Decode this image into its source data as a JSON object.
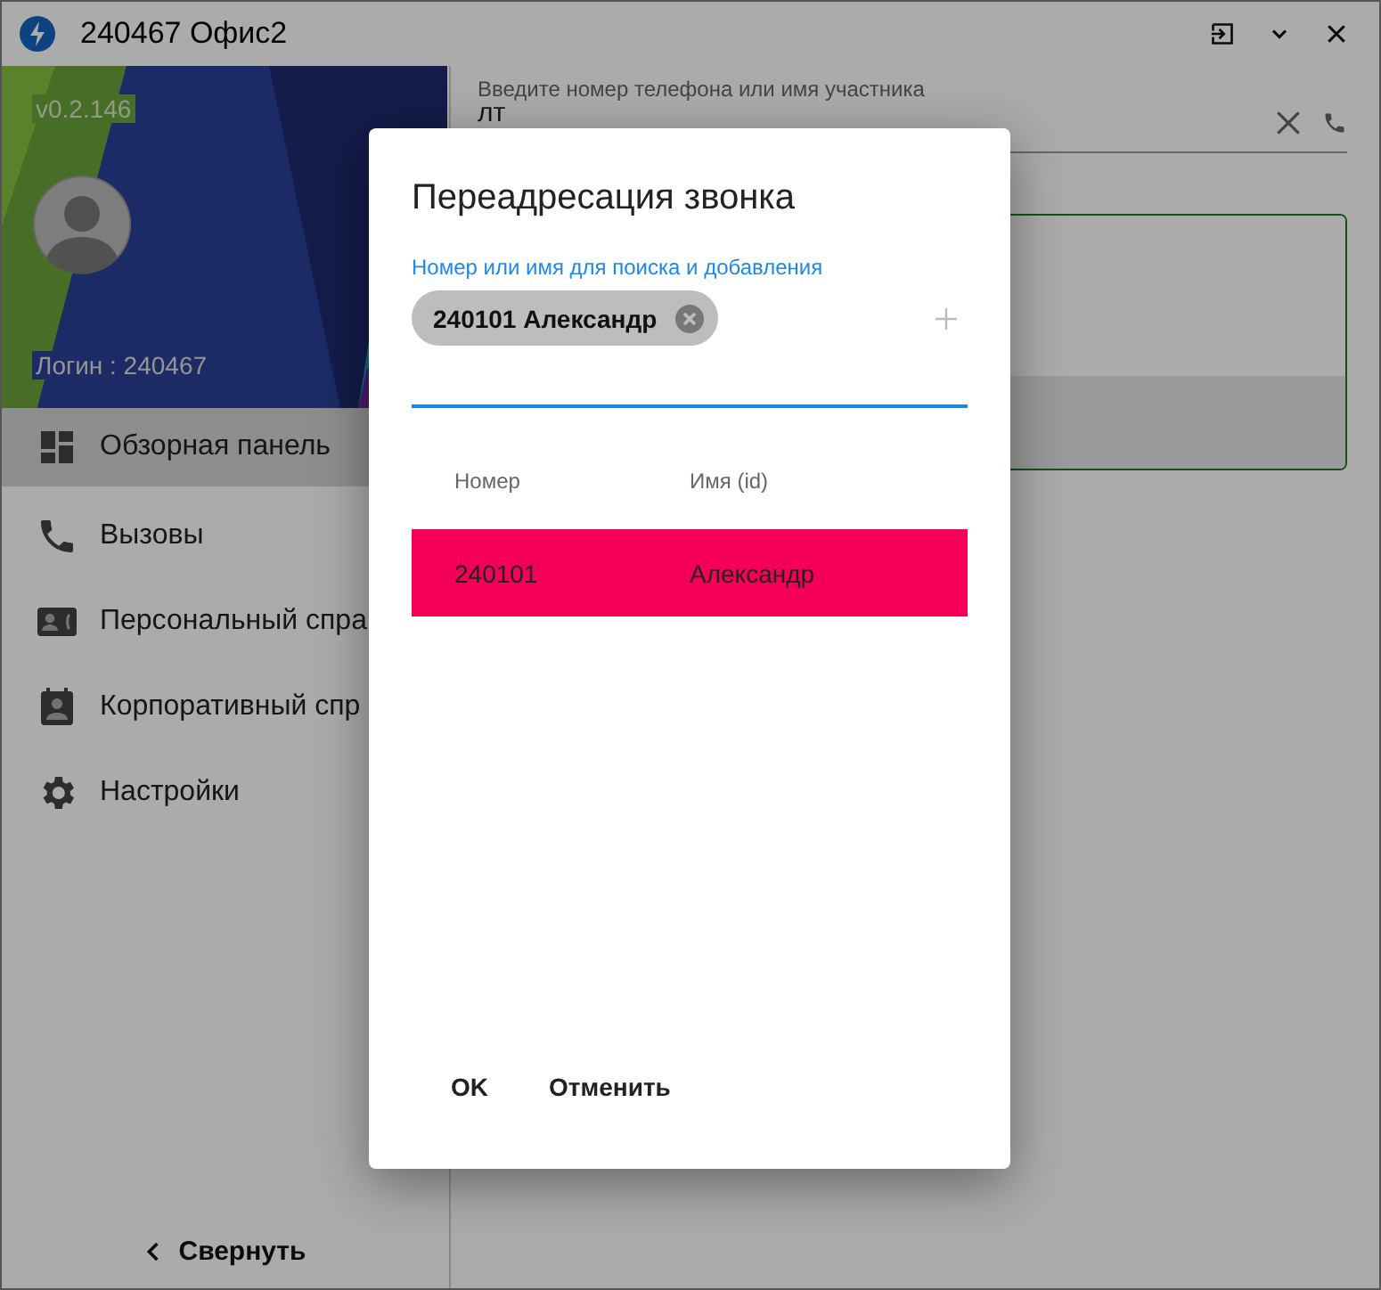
{
  "window": {
    "title": "240467 Офис2"
  },
  "sidebar": {
    "version": "v0.2.146",
    "login": "Логин : 240467",
    "items": [
      {
        "label": "Обзорная панель",
        "selected": true
      },
      {
        "label": "Вызовы",
        "selected": false
      },
      {
        "label": "Персональный спра",
        "selected": false
      },
      {
        "label": "Корпоративный спр",
        "selected": false
      },
      {
        "label": "Настройки",
        "selected": false
      }
    ],
    "collapse": "Свернуть"
  },
  "search": {
    "label": "Введите номер телефона или имя участника",
    "value": "лт"
  },
  "dialog": {
    "title": "Переадресация звонка",
    "field_label": "Номер или имя для поиска и добавления",
    "chips": [
      "240101 Александр"
    ],
    "columns": [
      "Номер",
      "Имя (id)"
    ],
    "rows": [
      {
        "cells": [
          "240101",
          "Александр"
        ],
        "selected": true
      }
    ],
    "buttons": [
      "OK",
      "Отменить"
    ]
  }
}
